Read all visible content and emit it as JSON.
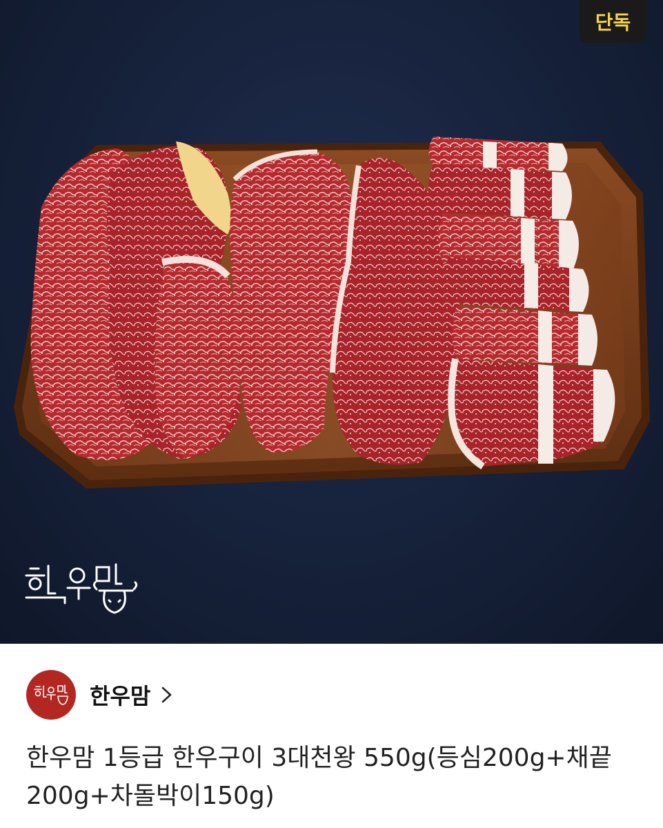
{
  "badge": {
    "label": "단독"
  },
  "hero": {
    "brand_logo_icon": "hanwoomam-logo-icon",
    "image_subject": "product-photo"
  },
  "seller": {
    "name": "한우맘",
    "avatar_icon": "hanwoomam-logo-icon",
    "chevron_icon": "chevron-right-icon"
  },
  "product": {
    "title": "한우맘 1등급 한우구이 3대천왕 550g(등심200g+채끝200g+차돌박이150g)"
  },
  "colors": {
    "background": "#16213a",
    "badge_bg": "#1a1a1a",
    "badge_text": "#f7d34a",
    "avatar_bg": "#b32722"
  }
}
